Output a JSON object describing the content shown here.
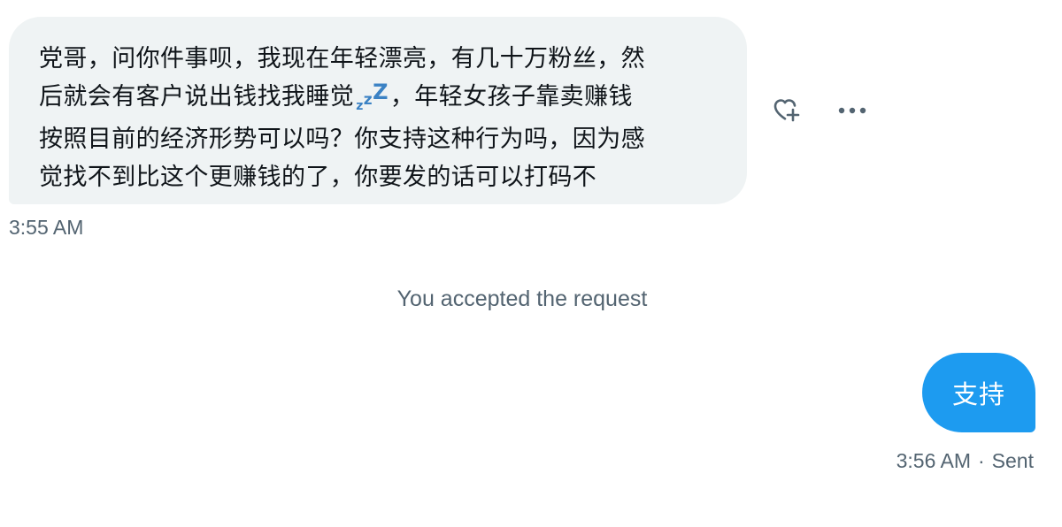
{
  "conversation": {
    "incoming": {
      "lines": [
        "党哥，问你件事呗，我现在年轻漂亮，有几十万粉丝，然",
        "后就会有客户说出钱找我睡觉",
        "，年轻女孩子靠卖赚钱",
        "按照目前的经济形势可以吗？你支持这种行为吗，因为感",
        "觉找不到比这个更赚钱的了，你要发的话可以打码不"
      ],
      "emoji": "zzZ",
      "timestamp": "3:55 AM"
    },
    "actions": {
      "react_icon": "heart-plus-icon",
      "more_icon": "more-horizontal-icon"
    },
    "system_note": "You accepted the request",
    "outgoing": {
      "text": "支持",
      "timestamp": "3:56 AM",
      "separator": "·",
      "status": "Sent"
    }
  },
  "colors": {
    "incoming_bubble": "#eff3f4",
    "outgoing_bubble": "#1d9bf0",
    "secondary_text": "#536471",
    "icon_color": "#536471",
    "sleep_emoji": "#3b82c4"
  }
}
